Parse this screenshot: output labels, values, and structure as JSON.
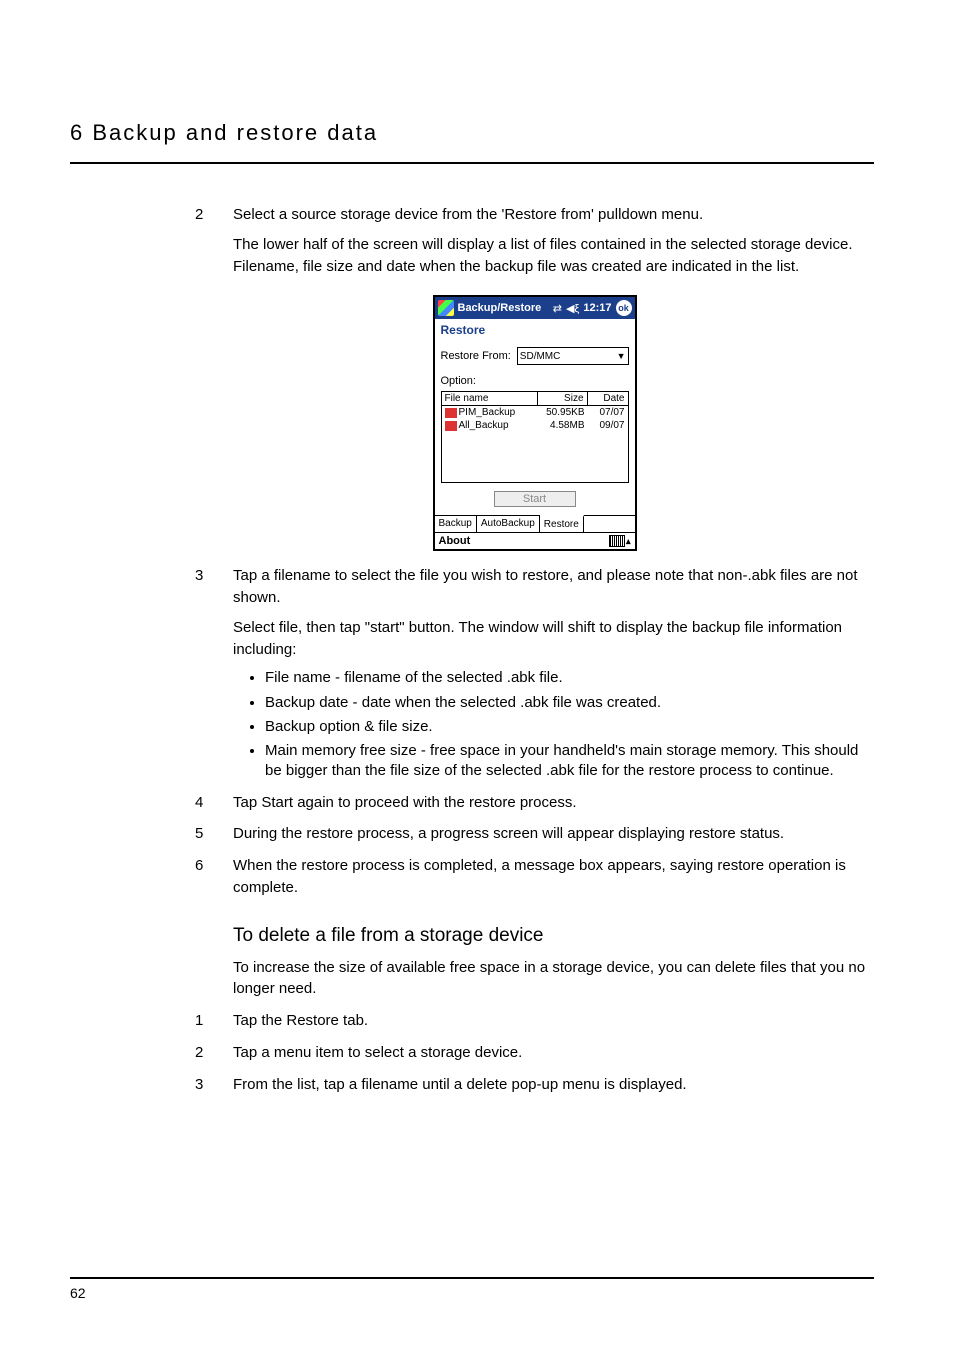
{
  "chapter_title": "6 Backup and restore data",
  "page_number": "62",
  "steps_a": [
    {
      "num": "2",
      "paras": [
        "Select a source storage device from the 'Restore from' pulldown menu.",
        "The lower half of the screen will display a list of files contained in the selected storage device. Filename, file size and date when the backup file was created are indicated in the list."
      ]
    }
  ],
  "steps_b": [
    {
      "num": "3",
      "paras": [
        "Tap a filename to select the file you wish to restore, and please note that non-.abk files are not shown.",
        "Select file, then tap \"start\" button. The window will shift to display the backup file information including:"
      ],
      "bullets": [
        "File name - filename of the selected .abk file.",
        "Backup date - date when the selected .abk file was created.",
        "Backup option & file size.",
        "Main memory free size - free space in your handheld's main storage memory. This should be bigger than the file size of the selected .abk file for the restore process to continue."
      ]
    },
    {
      "num": "4",
      "paras": [
        "Tap Start again to proceed with the restore process."
      ]
    },
    {
      "num": "5",
      "paras": [
        "During the restore process, a progress screen will appear displaying restore status."
      ]
    },
    {
      "num": "6",
      "paras": [
        "When the restore process is completed, a message box appears, saying restore operation is complete."
      ]
    }
  ],
  "subheading": "To delete a file from a storage device",
  "sub_intro": "To increase the size of available free space in a storage device, you can delete files that you no longer need.",
  "steps_c": [
    {
      "num": "1",
      "paras": [
        "Tap the Restore tab."
      ]
    },
    {
      "num": "2",
      "paras": [
        "Tap a menu item to select a storage device."
      ]
    },
    {
      "num": "3",
      "paras": [
        "From the list, tap a filename until a delete pop-up menu is displayed."
      ]
    }
  ],
  "device": {
    "app_title": "Backup/Restore",
    "time": "12:17",
    "ok": "ok",
    "restore_label": "Restore",
    "restore_from_label": "Restore From:",
    "restore_from_value": "SD/MMC",
    "option_label": "Option:",
    "columns": {
      "name": "File name",
      "size": "Size",
      "date": "Date"
    },
    "rows": [
      {
        "name": "PIM_Backup",
        "size": "50.95KB",
        "date": "07/07"
      },
      {
        "name": "All_Backup",
        "size": "4.58MB",
        "date": "09/07"
      }
    ],
    "start_label": "Start",
    "tabs": {
      "backup": "Backup",
      "auto": "AutoBackup",
      "restore": "Restore"
    },
    "about": "About"
  }
}
